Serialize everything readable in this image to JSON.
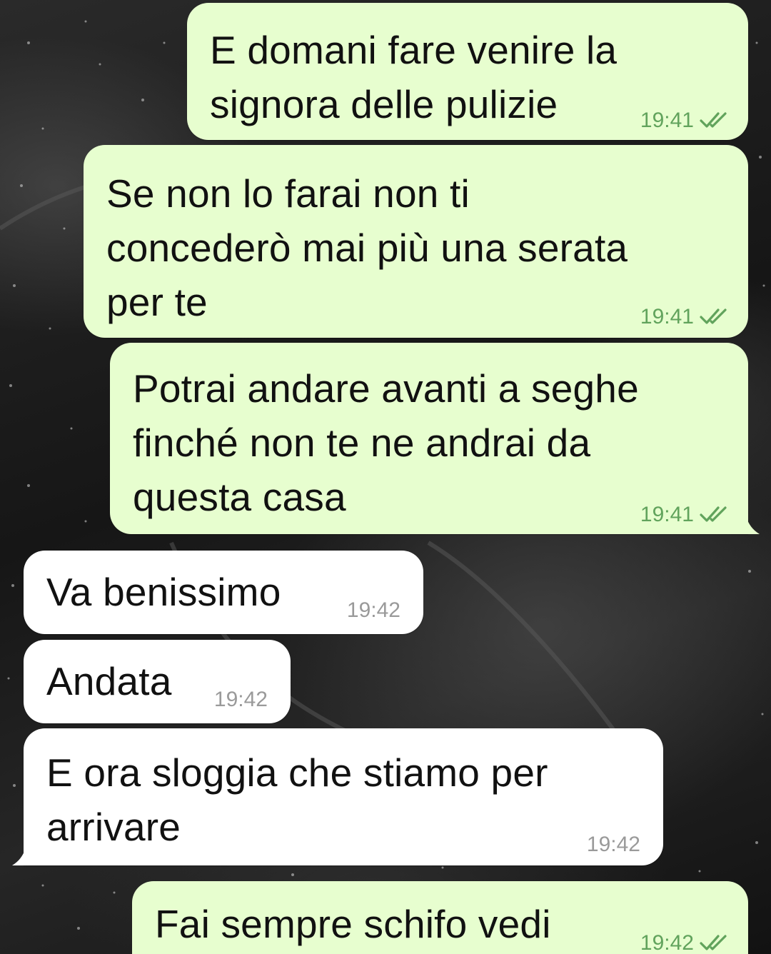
{
  "conversation": {
    "messages": [
      {
        "direction": "outgoing",
        "lines": [
          "E domani fare venire la",
          "signora delle pulizie"
        ],
        "time": "19:41",
        "status_icon": "double-check-icon"
      },
      {
        "direction": "outgoing",
        "lines": [
          "Se non lo farai non ti",
          "concederò mai più una serata",
          "per te"
        ],
        "time": "19:41",
        "status_icon": "double-check-icon"
      },
      {
        "direction": "outgoing",
        "lines": [
          "Potrai andare avanti a seghe",
          "finché non te ne andrai da",
          "questa casa"
        ],
        "time": "19:41",
        "status_icon": "double-check-icon"
      },
      {
        "direction": "incoming",
        "lines": [
          "Va benissimo"
        ],
        "time": "19:42"
      },
      {
        "direction": "incoming",
        "lines": [
          "Andata"
        ],
        "time": "19:42"
      },
      {
        "direction": "incoming",
        "lines": [
          "E ora sloggia che stiamo per",
          "arrivare"
        ],
        "time": "19:42"
      },
      {
        "direction": "outgoing",
        "lines": [
          "Fai sempre schifo vedi"
        ],
        "time": "19:42",
        "status_icon": "double-check-icon"
      }
    ]
  },
  "colors": {
    "outgoing_bubble": "#e7fecf",
    "incoming_bubble": "#ffffff",
    "outgoing_meta": "#61a35c",
    "incoming_meta": "#9a9a9a",
    "text": "#111111"
  }
}
